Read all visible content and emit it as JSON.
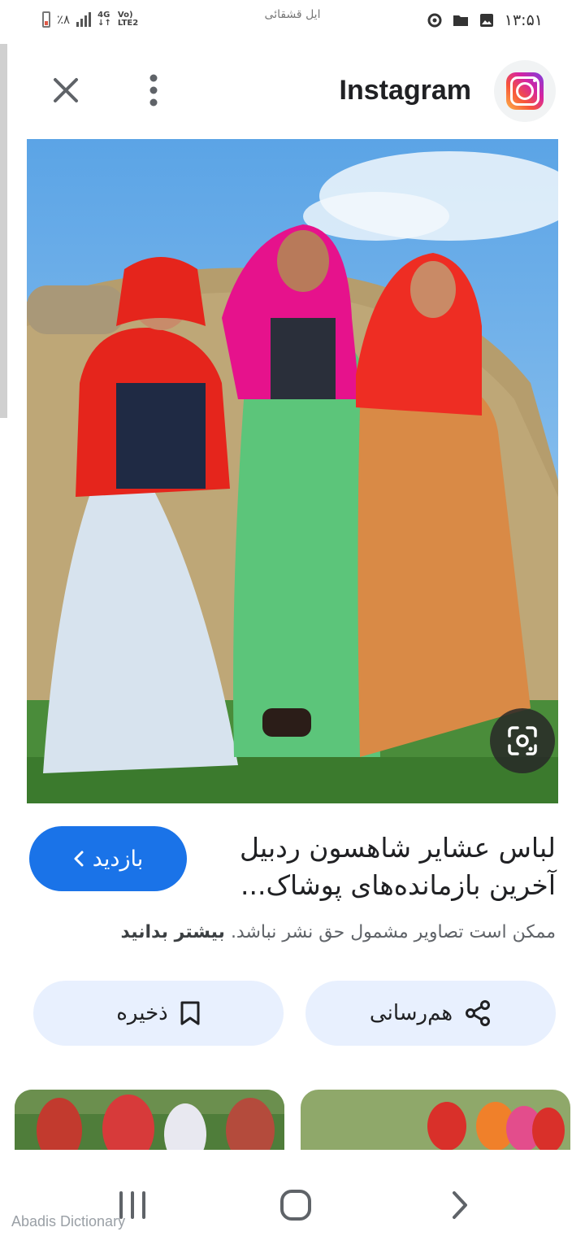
{
  "status_bar": {
    "battery_text": "٪۸",
    "network_top": "4G",
    "network_label_top": "Vo)",
    "network_label_bottom": "LTE2",
    "notification_title": "ایل قشقائی",
    "time": "۱۳:۵۱"
  },
  "header": {
    "source_name": "Instagram"
  },
  "result": {
    "title_line1": "لباس عشایر شاهسون ردبیل",
    "title_line2": "آخرین بازمانده‌های پوشاک...",
    "visit_label": "بازدید",
    "copyright_text": "ممکن است تصاویر مشمول حق نشر نباشد.",
    "learn_more": "بیشتر بدانید"
  },
  "actions": {
    "share_label": "هم‌رسانی",
    "save_label": "ذخیره"
  },
  "watermark": "Abadis Dictionary",
  "colors": {
    "accent": "#1a73e8",
    "action_bg": "#e8f0fe"
  },
  "icons": {
    "close": "close-icon",
    "more": "more-vert-icon",
    "lens": "lens-icon",
    "share": "share-icon",
    "save": "bookmark-icon",
    "nav_recents": "recents-icon",
    "nav_home": "home-icon",
    "nav_back": "back-icon"
  }
}
